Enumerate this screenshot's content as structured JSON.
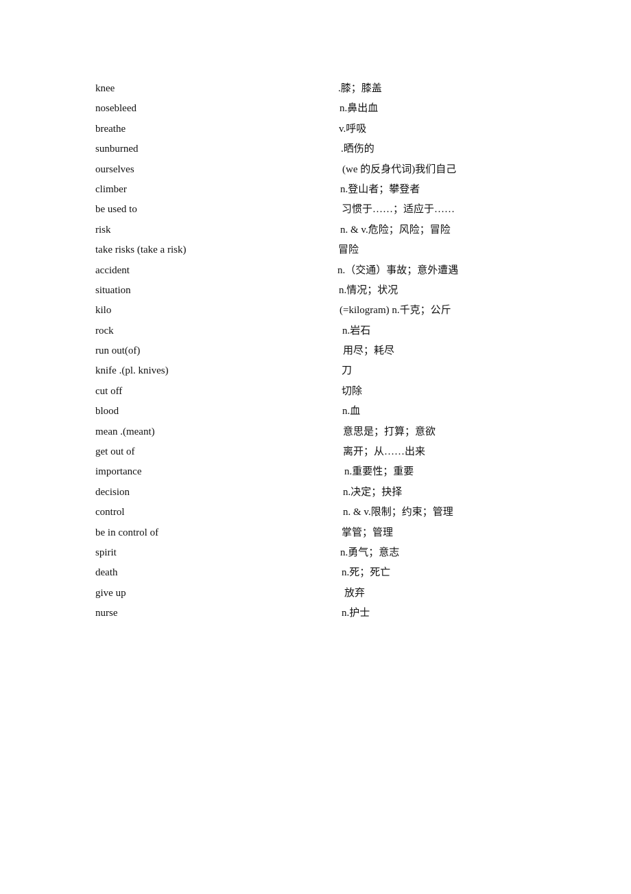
{
  "vocabulary": [
    {
      "word": "knee",
      "meaning": ".膝；膝盖"
    },
    {
      "word": "nosebleed",
      "meaning": "n.鼻出血"
    },
    {
      "word": "breathe",
      "meaning": "v.呼吸"
    },
    {
      "word": "sunburned",
      "meaning": ".晒伤的"
    },
    {
      "word": "ourselves",
      "meaning": "(we 的反身代词)我们自己"
    },
    {
      "word": "climber",
      "meaning": "n.登山者；攀登者"
    },
    {
      "word": "be used to",
      "meaning": "习惯于……；适应于……"
    },
    {
      "word": "risk",
      "meaning": "n. & v.危险；风险；冒险"
    },
    {
      "word": "take risks (take a risk)",
      "meaning": "冒险"
    },
    {
      "word": "accident",
      "meaning": "n.（交通）事故；意外遭遇"
    },
    {
      "word": "situation",
      "meaning": "n.情况；状况"
    },
    {
      "word": "kilo",
      "meaning": "(=kilogram) n.千克；公斤"
    },
    {
      "word": "rock",
      "meaning": "n.岩石"
    },
    {
      "word": "run out(of)",
      "meaning": "用尽；耗尽"
    },
    {
      "word": "knife .(pl. knives)",
      "meaning": "刀"
    },
    {
      "word": "cut off",
      "meaning": "切除"
    },
    {
      "word": "blood",
      "meaning": "n.血"
    },
    {
      "word": "mean .(meant)",
      "meaning": "意思是；打算；意欲"
    },
    {
      "word": "get out of",
      "meaning": "离开；从……出来"
    },
    {
      "word": "importance",
      "meaning": "n.重要性；重要"
    },
    {
      "word": "decision",
      "meaning": "n.决定；抉择"
    },
    {
      "word": "control",
      "meaning": "n. & v.限制；约束；管理"
    },
    {
      "word": "be in control of",
      "meaning": "掌管；管理"
    },
    {
      "word": "spirit",
      "meaning": "n.勇气；意志"
    },
    {
      "word": "death",
      "meaning": "n.死；死亡"
    },
    {
      "word": "give up",
      "meaning": "放弃"
    },
    {
      "word": "nurse",
      "meaning": "n.护士"
    }
  ]
}
